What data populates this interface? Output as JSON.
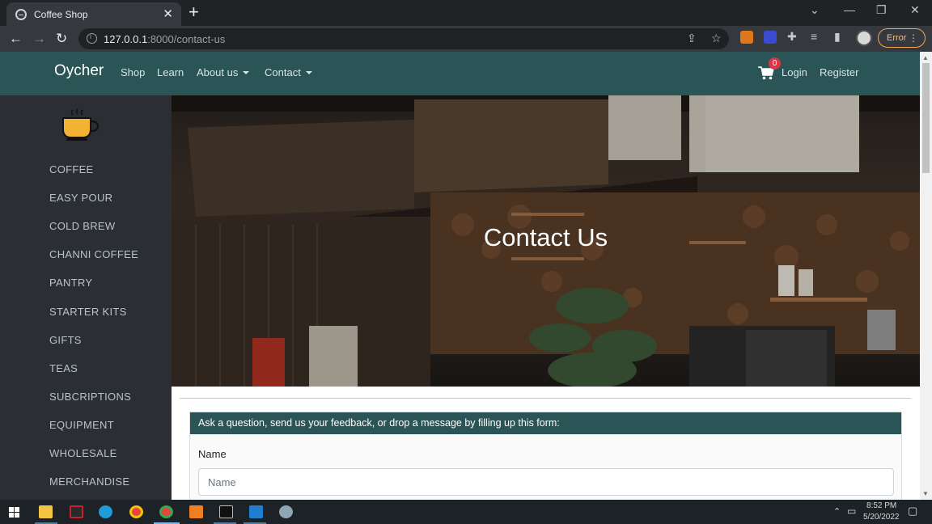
{
  "browser": {
    "tab_title": "Coffee Shop",
    "url_host": "127.0.0.1",
    "url_rest": ":8000/contact-us",
    "error_label": "Error"
  },
  "site": {
    "brand": "Oycher",
    "nav": [
      {
        "label": "Shop"
      },
      {
        "label": "Learn"
      },
      {
        "label": "About us"
      },
      {
        "label": "Contact"
      }
    ],
    "cart_count": "0",
    "login": "Login",
    "register": "Register"
  },
  "sidebar": {
    "items": [
      {
        "label": "COFFEE"
      },
      {
        "label": "EASY POUR"
      },
      {
        "label": "COLD BREW"
      },
      {
        "label": "CHANNI COFFEE"
      },
      {
        "label": "PANTRY"
      },
      {
        "label": "STARTER KITS"
      },
      {
        "label": "GIFTS"
      },
      {
        "label": "TEAS"
      },
      {
        "label": "SUBCRIPTIONS"
      },
      {
        "label": "EQUIPMENT"
      },
      {
        "label": "WHOLESALE"
      },
      {
        "label": "MERCHANDISE"
      }
    ]
  },
  "hero": {
    "title": "Contact Us"
  },
  "form": {
    "header": "Ask a question, send us your feedback, or drop a message by filling up this form:",
    "name_label": "Name",
    "name_placeholder": "Name"
  },
  "taskbar": {
    "time": "8:52 PM",
    "date": "5/20/2022"
  },
  "colors": {
    "navbar": "#2b5456",
    "sidebar": "#2b2f33",
    "badge": "#dc3545"
  }
}
